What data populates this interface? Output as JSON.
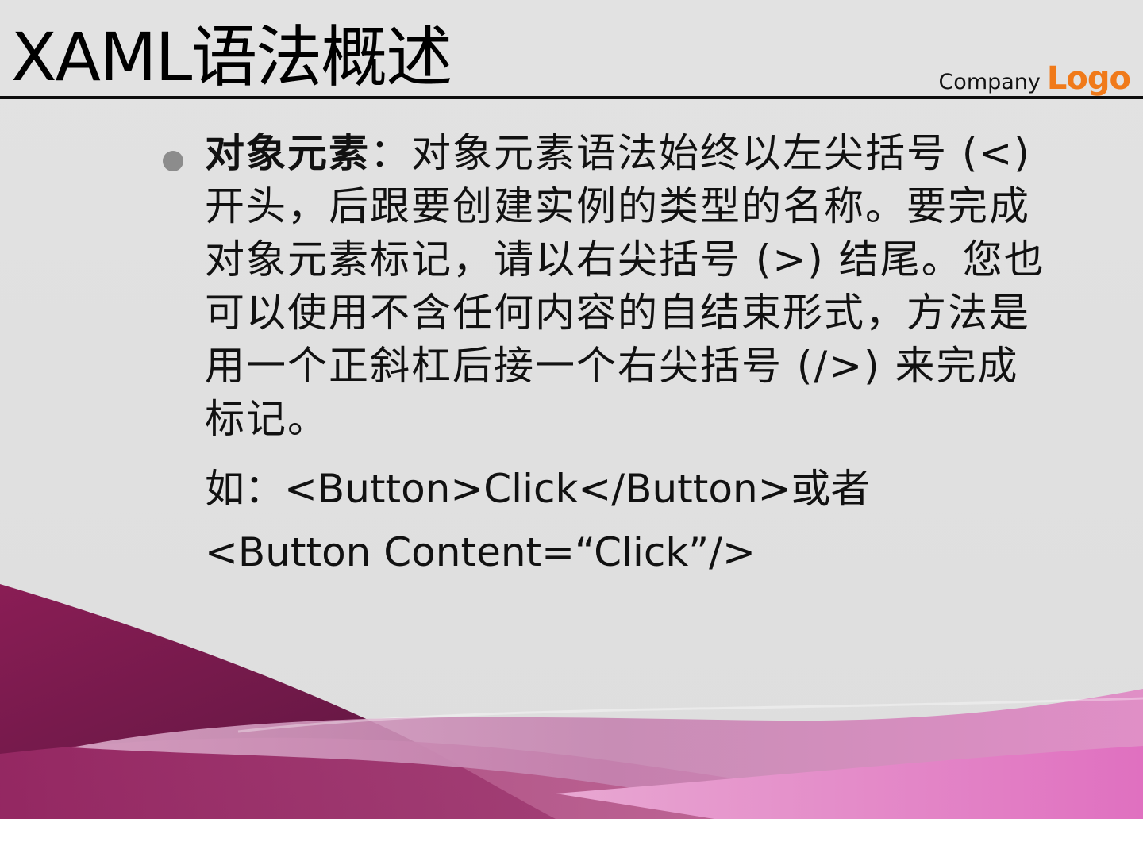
{
  "slide": {
    "title": "XAML语法概述",
    "logo": {
      "company": "Company",
      "word": "Logo",
      "word_color": "#f07a1a"
    },
    "bullet": {
      "term": "对象元素",
      "separator": "：",
      "body": "对象元素语法始终以左尖括号 (<) 开头，后跟要创建实例的类型的名称。要完成对象元素标记，请以右尖括号 (>) 结尾。您也可以使用不含任何内容的自结束形式，方法是用一个正斜杠后接一个右尖括号 (/>) 来完成标记。"
    },
    "examples": [
      "如：<Button>Click</Button>或者",
      "<Button Content=“Click”/>"
    ],
    "decoration": {
      "wave_colors": [
        "#6e1a48",
        "#8c1f55",
        "#c07aa8",
        "#e48cc4"
      ]
    }
  }
}
